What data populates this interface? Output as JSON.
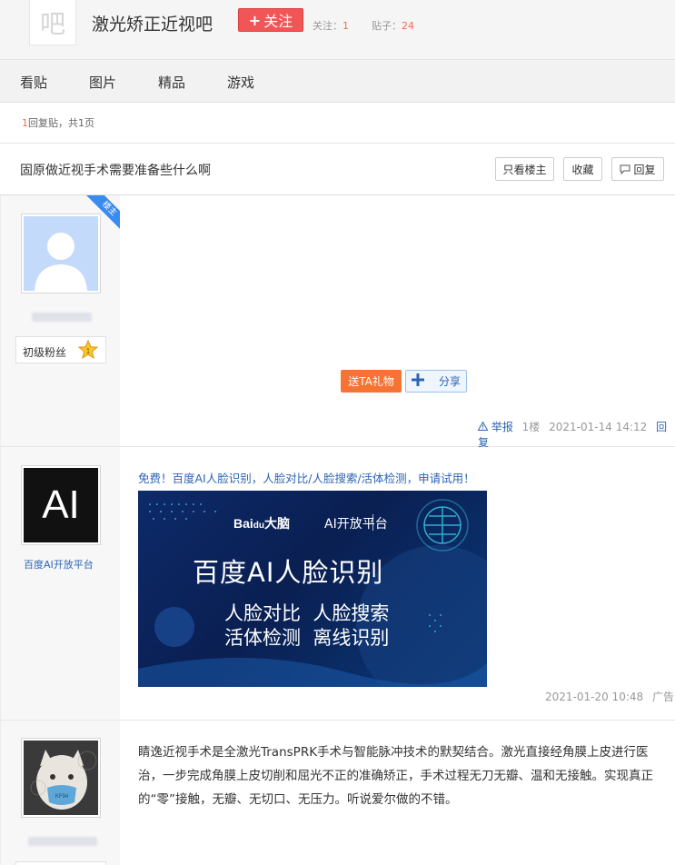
{
  "header": {
    "bar_logo": "吧",
    "bar_name": "激光矫正近视吧",
    "follow_label": "关注",
    "follow_prefix": "+",
    "followers_label": "关注：",
    "followers_count": "1",
    "posts_label": "贴子：",
    "posts_count": "24"
  },
  "tabs": [
    "看贴",
    "图片",
    "精品",
    "游戏"
  ],
  "pager": {
    "count": "1",
    "text": "回复贴，共1页"
  },
  "thread": {
    "title": "固原做近视手术需要准备些什么啊",
    "btn_only_op": "只看楼主",
    "btn_collect": "收藏",
    "btn_reply": "回复"
  },
  "post1": {
    "ribbon": "楼主",
    "badge_label": "初级粉丝",
    "badge_level": "1",
    "gift_label": "送TA礼物",
    "share_label": "分享",
    "report_label": "举报",
    "floor": "1楼",
    "time": "2021-01-14 14:12",
    "reply_label": "回复"
  },
  "post2": {
    "avatar_text": "AI",
    "author": "百度AI开放平台",
    "link_text": "免费！百度AI人脸识别，人脸对比/人脸搜索/活体检测，申请试用！",
    "banner_brand_bai": "Bai",
    "banner_brand_du": "du",
    "banner_brand_naol": "大脑",
    "banner_brand_platform": "AI开放平台",
    "banner_title": "百度AI人脸识别",
    "banner_line1": "人脸对比  人脸搜索",
    "banner_line2": "活体检测  离线识别",
    "time": "2021-01-20 10:48",
    "ad_label": "广告"
  },
  "post3": {
    "avatar_mask_text": "KF94",
    "content": "睛逸近视手术是全激光TransPRK手术与智能脉冲技术的默契结合。激光直接经角膜上皮进行医治，一步完成角膜上皮切削和屈光不正的准确矫正，手术过程无刀无瓣、温和无接触。实现真正的“零”接触，无瓣、无切口、无压力。听说爱尔做的不错。"
  },
  "colors": {
    "follow_red": "#f25555",
    "count_orange": "#f26c4f",
    "link_blue": "#2d64b3",
    "gift_orange": "#f77334",
    "ribbon_blue": "#3a8af0"
  }
}
